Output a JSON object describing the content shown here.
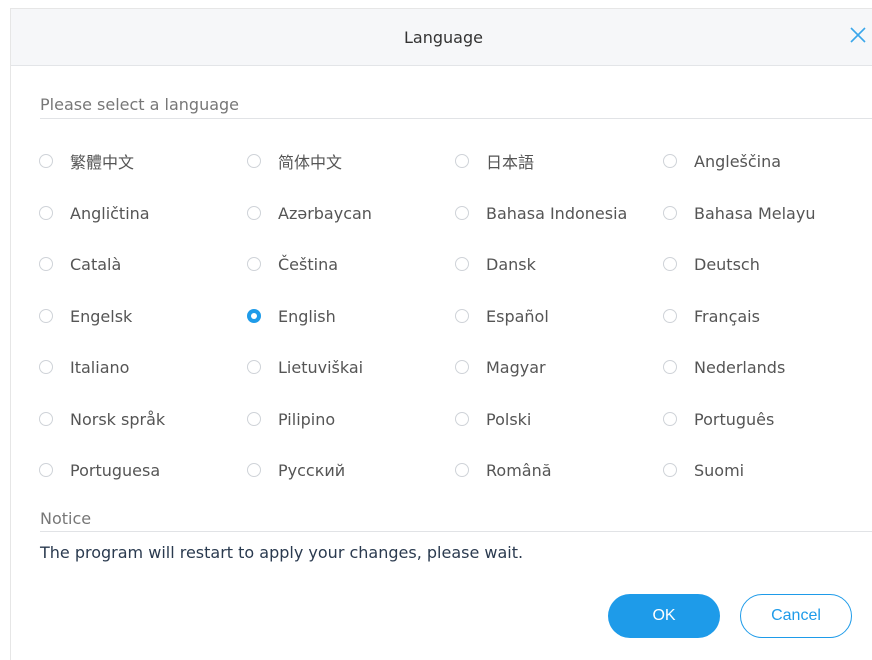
{
  "dialog": {
    "title": "Language",
    "close_icon": "close-icon",
    "select_label": "Please select a language",
    "notice_label": "Notice",
    "notice_text": "The program will restart to apply your changes, please wait.",
    "ok_label": "OK",
    "cancel_label": "Cancel",
    "accent_color": "#1e9be9"
  },
  "languages": [
    {
      "label": "繁體中文",
      "selected": false
    },
    {
      "label": "简体中文",
      "selected": false
    },
    {
      "label": "日本語",
      "selected": false
    },
    {
      "label": "Angleščina",
      "selected": false
    },
    {
      "label": "Angličtina",
      "selected": false
    },
    {
      "label": "Azərbaycan",
      "selected": false
    },
    {
      "label": "Bahasa Indonesia",
      "selected": false
    },
    {
      "label": "Bahasa Melayu",
      "selected": false
    },
    {
      "label": "Català",
      "selected": false
    },
    {
      "label": "Čeština",
      "selected": false
    },
    {
      "label": "Dansk",
      "selected": false
    },
    {
      "label": "Deutsch",
      "selected": false
    },
    {
      "label": "Engelsk",
      "selected": false
    },
    {
      "label": "English",
      "selected": true
    },
    {
      "label": "Español",
      "selected": false
    },
    {
      "label": "Français",
      "selected": false
    },
    {
      "label": "Italiano",
      "selected": false
    },
    {
      "label": "Lietuviškai",
      "selected": false
    },
    {
      "label": "Magyar",
      "selected": false
    },
    {
      "label": "Nederlands",
      "selected": false
    },
    {
      "label": "Norsk språk",
      "selected": false
    },
    {
      "label": "Pilipino",
      "selected": false
    },
    {
      "label": "Polski",
      "selected": false
    },
    {
      "label": "Português",
      "selected": false
    },
    {
      "label": "Portuguesa",
      "selected": false
    },
    {
      "label": "Русский",
      "selected": false
    },
    {
      "label": "Română",
      "selected": false
    },
    {
      "label": "Suomi",
      "selected": false
    }
  ]
}
